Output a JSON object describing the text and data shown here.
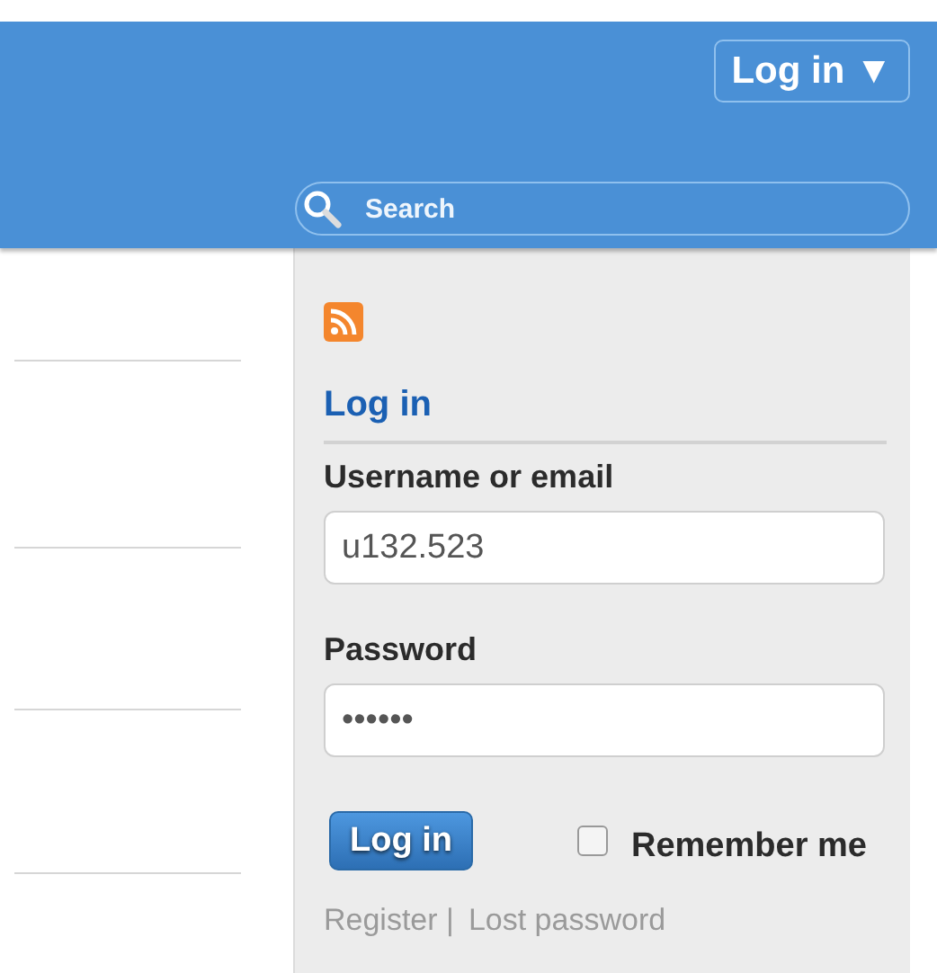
{
  "header": {
    "login_menu": "Log in ▼",
    "search": {
      "placeholder": "Search"
    }
  },
  "sidebar": {
    "heading": "Log in",
    "fields": [
      {
        "label": "Username or email",
        "value": "u132.523"
      },
      {
        "label": "Password",
        "value": "••••••"
      }
    ],
    "submit": "Log in",
    "remember": {
      "label": "Remember me",
      "checked": false
    },
    "links": [
      {
        "text": "Register |"
      },
      {
        "text": "Lost password"
      }
    ]
  }
}
